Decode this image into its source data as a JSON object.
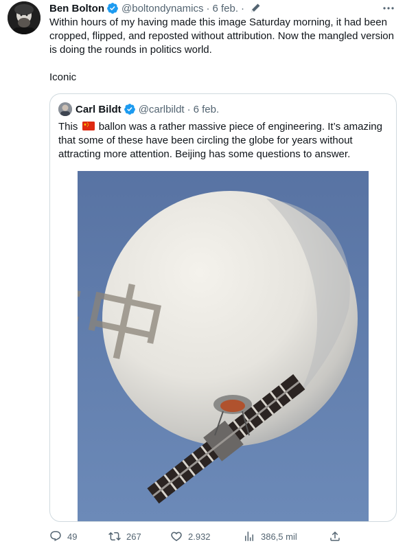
{
  "tweet": {
    "author_name": "Ben Bolton",
    "author_handle": "@boltondynamics",
    "separator": "·",
    "date": "6 feb.",
    "text": "Within hours of my having made this image Saturday morning, it had been cropped, flipped, and reposted without attribution. Now the mangled version is doing the rounds in politics world.\n\nIconic",
    "avatar_icon": "user-avatar",
    "verified_icon": "verified-badge-icon",
    "edit_icon": "edited-pencil-icon",
    "more_icon": "more-options-icon"
  },
  "quoted_tweet": {
    "author_name": "Carl Bildt",
    "author_handle": "@carlbildt",
    "separator": "·",
    "date": "6 feb.",
    "text_before_flag": "This",
    "flag_icon": "china-flag-emoji",
    "text_after_flag": "ballon was a rather massive piece of engineering. It’s amazing that some of these have been circling the globe for years without attracting more attention. Beijing has some questions to answer.",
    "media_description": "balloon-photo",
    "media_text": "中共"
  },
  "actions": {
    "replies": "49",
    "retweets": "267",
    "likes": "2.932",
    "views": "386,5 mil",
    "reply_icon": "reply-icon",
    "retweet_icon": "retweet-icon",
    "like_icon": "heart-icon",
    "views_icon": "views-chart-icon",
    "share_icon": "share-icon"
  },
  "colors": {
    "text": "#0f1419",
    "secondary": "#536471",
    "verified": "#1d9bf0",
    "border": "#cfd9de",
    "sky": "#5b7aa8"
  }
}
